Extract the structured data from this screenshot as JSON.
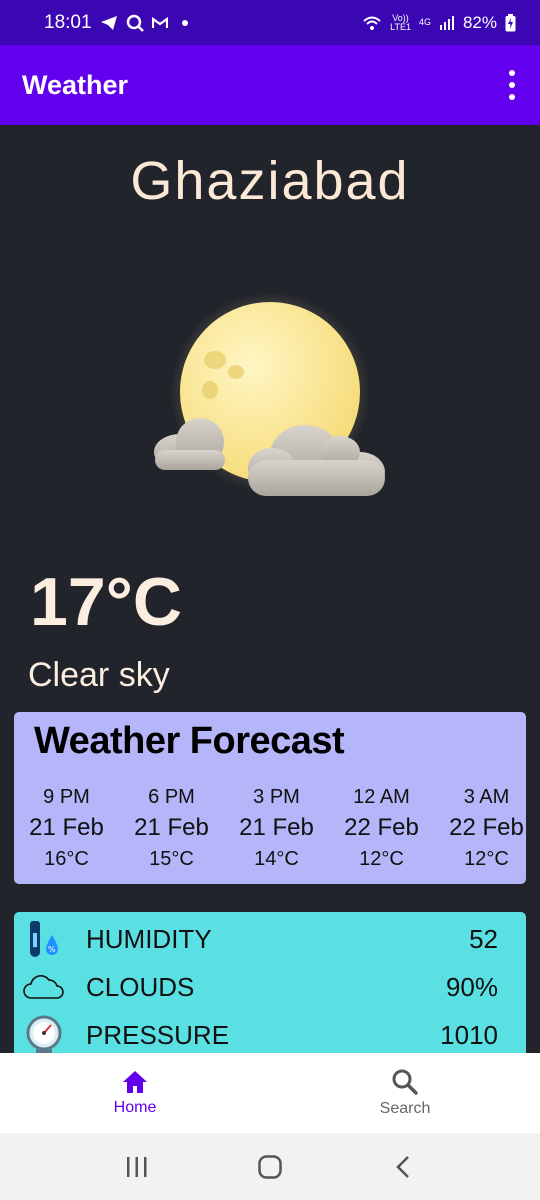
{
  "status_bar": {
    "time": "18:01",
    "network_top": "Vo))",
    "network_bottom": "LTE1",
    "net_type": "4G",
    "battery": "82%"
  },
  "app_bar": {
    "title": "Weather"
  },
  "current": {
    "city": "Ghaziabad",
    "temperature": "17°C",
    "description": "Clear sky"
  },
  "forecast": {
    "title": "Weather Forecast",
    "items": [
      {
        "time": "9 PM",
        "date": "21 Feb",
        "temp": "16°C"
      },
      {
        "time": "6 PM",
        "date": "21 Feb",
        "temp": "15°C"
      },
      {
        "time": "3 PM",
        "date": "21 Feb",
        "temp": "14°C"
      },
      {
        "time": "12 AM",
        "date": "22 Feb",
        "temp": "12°C"
      },
      {
        "time": "3 AM",
        "date": "22 Feb",
        "temp": "12°C"
      }
    ]
  },
  "details": [
    {
      "label": "HUMIDITY",
      "value": "52",
      "icon": "humidity-icon"
    },
    {
      "label": "CLOUDS",
      "value": "90%",
      "icon": "cloud-icon"
    },
    {
      "label": "PRESSURE",
      "value": "1010",
      "icon": "pressure-gauge-icon"
    }
  ],
  "bottom_nav": {
    "home_label": "Home",
    "search_label": "Search"
  },
  "colors": {
    "status_bar": "#3b07b3",
    "app_bar": "#6200ee",
    "background": "#22242b",
    "forecast_card": "#b5b5fa",
    "details_card": "#5ae0e3",
    "accent": "#6200ee"
  }
}
